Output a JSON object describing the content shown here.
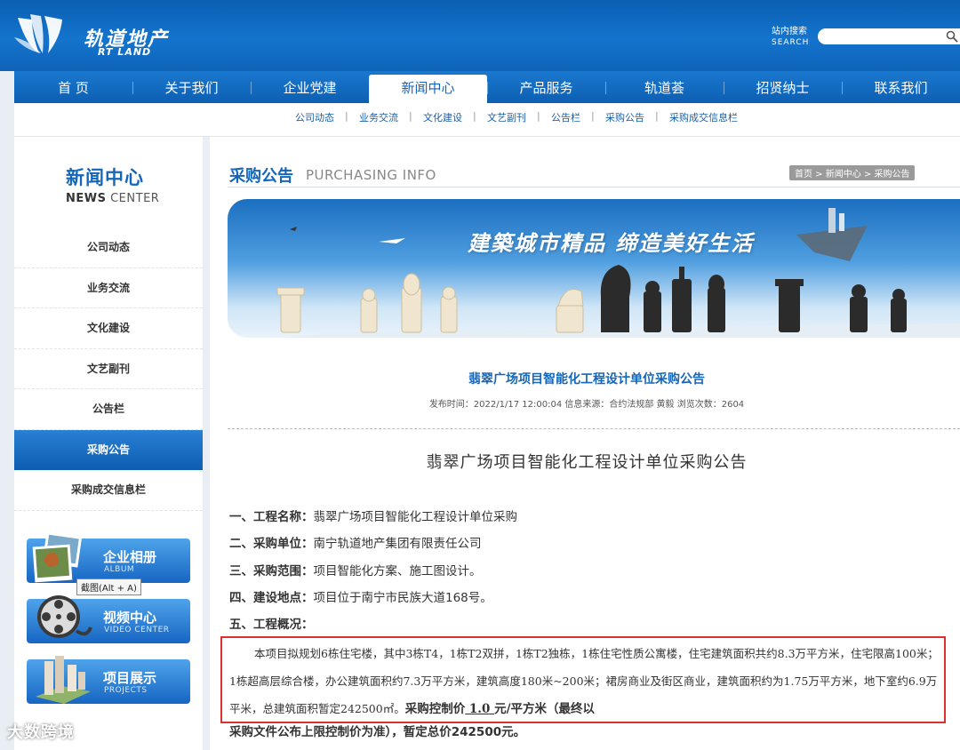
{
  "header": {
    "logo_cn": "轨道地产",
    "logo_en": "RT LAND",
    "search_label_cn": "站内搜索",
    "search_label_en": "SEARCH"
  },
  "nav": [
    {
      "label": "首 页"
    },
    {
      "label": "关于我们"
    },
    {
      "label": "企业党建"
    },
    {
      "label": "新闻中心",
      "active": true
    },
    {
      "label": "产品服务"
    },
    {
      "label": "轨道荟"
    },
    {
      "label": "招贤纳士"
    },
    {
      "label": "联系我们"
    }
  ],
  "subnav": [
    "公司动态",
    "业务交流",
    "文化建设",
    "文艺副刊",
    "公告栏",
    "采购公告",
    "采购成交信息栏"
  ],
  "sidebar": {
    "title_cn": "新闻中心",
    "title_en_1": "NEWS",
    "title_en_2": "CENTER",
    "items": [
      {
        "label": "公司动态"
      },
      {
        "label": "业务交流"
      },
      {
        "label": "文化建设"
      },
      {
        "label": "文艺副刊"
      },
      {
        "label": "公告栏"
      },
      {
        "label": "采购公告",
        "active": true
      },
      {
        "label": "采购成交信息栏"
      }
    ],
    "promos": [
      {
        "title": "企业相册",
        "sub": "ALBUM"
      },
      {
        "title": "视频中心",
        "sub": "VIDEO CENTER"
      },
      {
        "title": "项目展示",
        "sub": "PROJECTS"
      }
    ],
    "tooltip": "截图(Alt + A)"
  },
  "main": {
    "title": "采购公告",
    "title_en": "PURCHASING INFO",
    "breadcrumb": "首页 > 新闻中心 > 采购公告",
    "banner_slogan": "建築城市精品 缔造美好生活",
    "article_title": "翡翠广场项目智能化工程设计单位采购公告",
    "article_meta": "发布时间：2022/1/17 12:00:04  信息来源：合约法规部 黄毅  浏览次数：2604",
    "article_heading": "翡翠广场项目智能化工程设计单位采购公告",
    "items": [
      {
        "label": "一、工程名称：",
        "value": "翡翠广场项目智能化工程设计单位采购"
      },
      {
        "label": "二、采购单位：",
        "value": "南宁轨道地产集团有限责任公司"
      },
      {
        "label": "三、采购范围：",
        "value": "项目智能化方案、施工图设计。"
      },
      {
        "label": "四、建设地点：",
        "value": "项目位于南宁市民族大道168号。"
      },
      {
        "label": "五、工程概况：",
        "value": ""
      }
    ],
    "overview_text": "本项目拟规划6栋住宅楼，其中3栋T4，1栋T2双拼，1栋T2独栋，1栋住宅性质公寓楼，住宅建筑面积共约8.3万平方米，住宅限高100米；1栋超高层综合楼，办公建筑面积约7.3万平方米，建筑高度180米~200米；裙房商业及街区商业，建筑面积约为1.75万平方米，地下室约6.9万平米，总建筑面积暂定242500㎡。",
    "price_label": "采购控制价",
    "price_value": " 1.0 ",
    "price_unit": "元/平方米（最终以",
    "last_line": "采购文件公布上限控制价为准），暂定总价242500元。"
  },
  "watermark": "大数跨境"
}
